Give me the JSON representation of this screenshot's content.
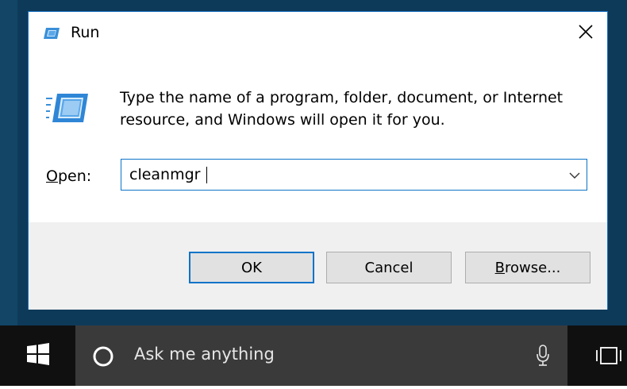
{
  "dialog": {
    "title": "Run",
    "close_glyph": "✕",
    "description": "Type the name of a program, folder, document, or Internet resource, and Windows will open it for you.",
    "open_label_mnemonic": "O",
    "open_label_rest": "pen:",
    "open_value": "cleanmgr",
    "buttons": {
      "ok": "OK",
      "cancel": "Cancel",
      "browse_mnemonic": "B",
      "browse_rest": "rowse..."
    }
  },
  "taskbar": {
    "search_placeholder": "Ask me anything"
  },
  "icons": [
    "run-icon",
    "close-icon",
    "chevron-down-icon",
    "windows-logo-icon",
    "cortana-icon",
    "microphone-icon",
    "task-view-icon"
  ],
  "colors": {
    "accent": "#0d73c8",
    "desktop": "#0e3a5a",
    "taskbar": "#101010",
    "search_box": "#3a3a3a",
    "footer": "#f0f0f0"
  }
}
